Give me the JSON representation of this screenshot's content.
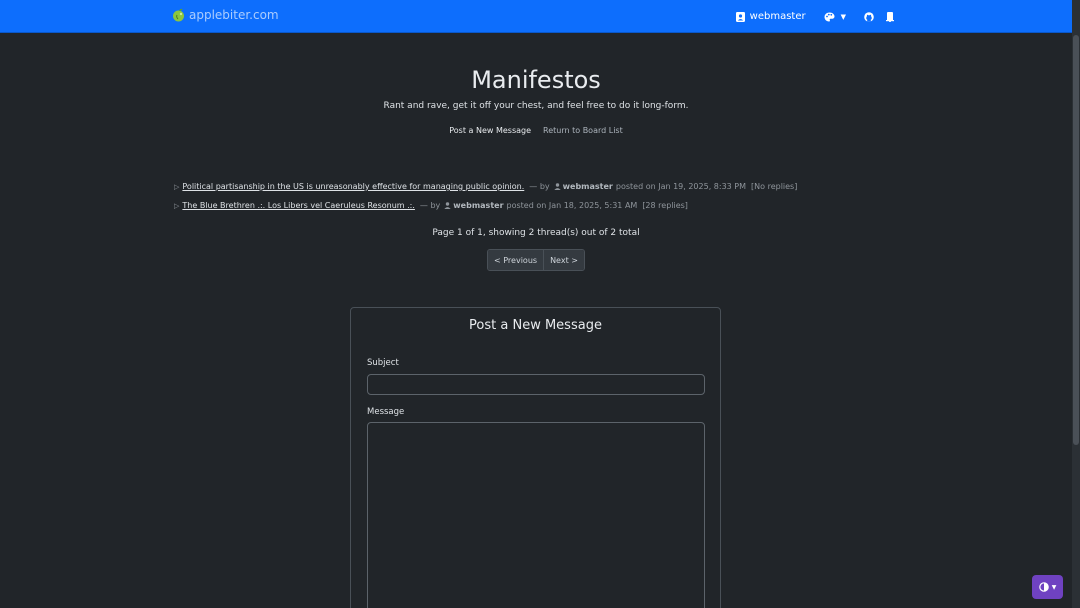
{
  "navbar": {
    "brand": "applebiter.com",
    "user": "webmaster",
    "brand_color": "#0d6efd"
  },
  "header": {
    "title": "Manifestos",
    "subtitle": "Rant and rave, get it off your chest, and feel free to do it long-form.",
    "link_post": "Post a New Message",
    "link_return": "Return to Board List"
  },
  "threads": [
    {
      "title": "Political partisanship in the US is unreasonably effective for managing public opinion.",
      "by": "— by",
      "user": "webmaster",
      "posted": "posted on Jan 19, 2025, 8:33 PM",
      "replies": "[No replies]"
    },
    {
      "title": "The Blue Brethren .:. Los Libers vel Caeruleus Resonum .:.",
      "by": "— by",
      "user": "webmaster",
      "posted": "posted on Jan 18, 2025, 5:31 AM",
      "replies": "[28 replies]"
    }
  ],
  "pagination": {
    "info": "Page 1 of 1, showing 2 thread(s) out of 2 total",
    "prev": "< Previous",
    "next": "Next >"
  },
  "form": {
    "title": "Post a New Message",
    "subject_label": "Subject",
    "subject_value": "",
    "message_label": "Message",
    "message_value": ""
  },
  "icons": {
    "brand": "apple-logo-icon",
    "user": "user-badge-icon",
    "theme": "palette-icon",
    "github": "github-icon",
    "notifications": "bell-icon",
    "contrast": "contrast-icon"
  },
  "colors": {
    "background": "#212529",
    "accent_toggle": "#6f42c1"
  }
}
